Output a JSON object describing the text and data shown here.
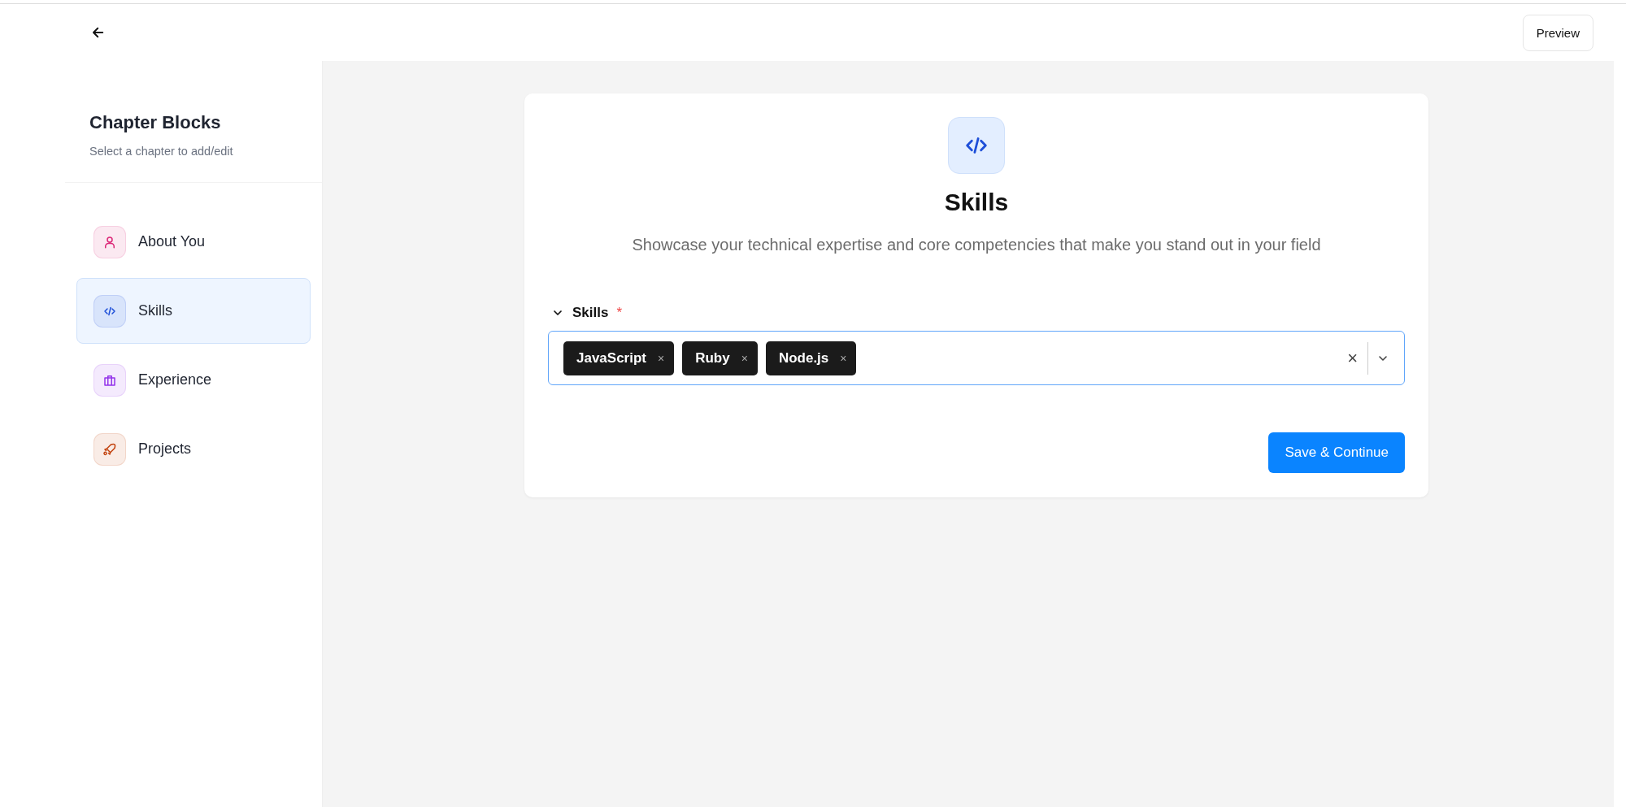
{
  "header": {
    "preview_button": "Preview"
  },
  "sidebar": {
    "title": "Chapter Blocks",
    "subtitle": "Select a chapter to add/edit",
    "items": [
      {
        "label": "About You",
        "selected": false,
        "color": "#db2777"
      },
      {
        "label": "Skills",
        "selected": true,
        "color": "#1d4ed8"
      },
      {
        "label": "Experience",
        "selected": false,
        "color": "#9333ea"
      },
      {
        "label": "Projects",
        "selected": false,
        "color": "#c2410c"
      }
    ]
  },
  "card": {
    "title": "Skills",
    "description": "Showcase your technical expertise and core competencies that make you stand out in your field",
    "field": {
      "label": "Skills",
      "required_mark": "*",
      "expanded": true,
      "tags": [
        {
          "label": "JavaScript",
          "remove": "×"
        },
        {
          "label": "Ruby",
          "remove": "×"
        },
        {
          "label": "Node.js",
          "remove": "×"
        }
      ],
      "clear": "×"
    },
    "submit_button": "Save & Continue"
  }
}
